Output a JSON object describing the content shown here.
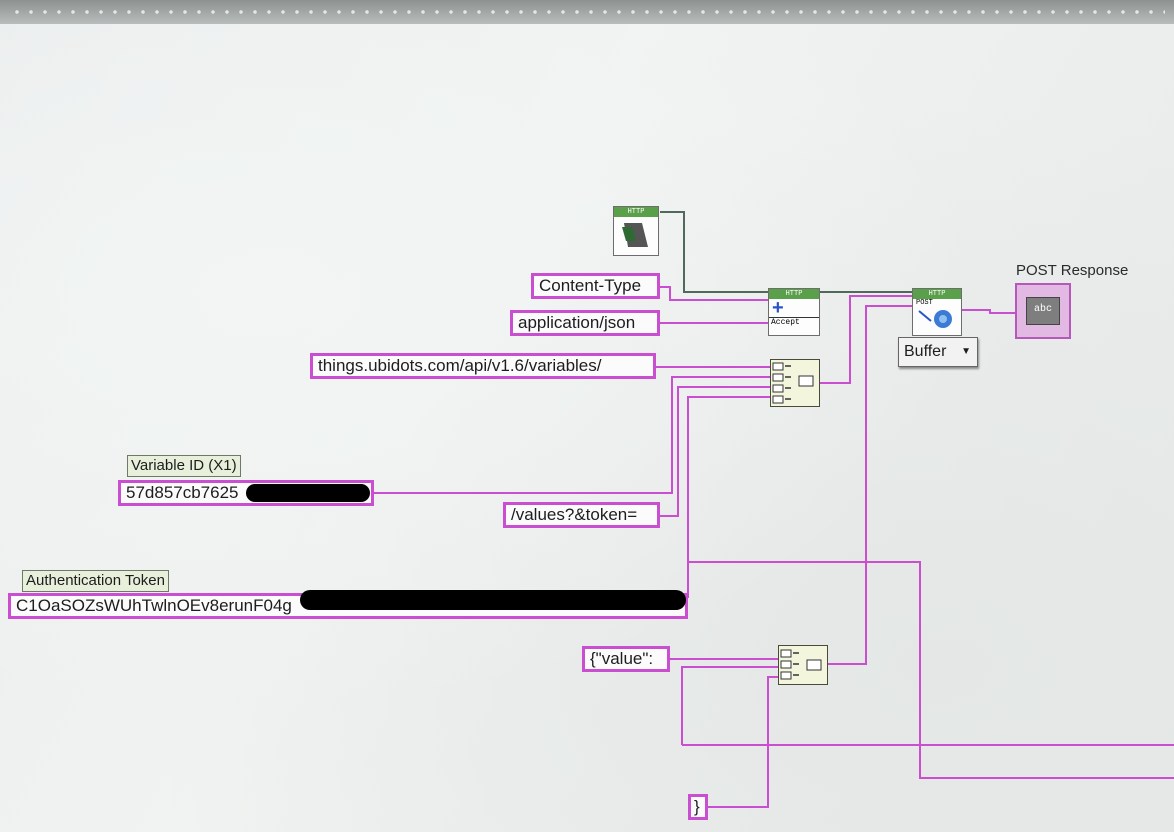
{
  "constants": {
    "content_type": "Content-Type",
    "application_json": "application/json",
    "url_base": "things.ubidots.com/api/v1.6/variables/",
    "variable_id": "57d857cb7625",
    "values_token": "/values?&token=",
    "auth_token": "C1OaSOZsWUhTwlnOEv8erunF04g",
    "value_prefix": "{\"value\":",
    "close_brace": "}"
  },
  "labels": {
    "variable_id": "Variable ID (X1)",
    "auth_token": "Authentication Token",
    "post_response": "POST Response"
  },
  "nodes": {
    "http_header": "HTTP",
    "post_mode": "POST",
    "add_header_caption": "Accept",
    "indicator_glyph": "abc"
  },
  "ring": {
    "value": "Buffer"
  },
  "colors": {
    "string_wire": "#c94fd0",
    "refnum_wire": "#4f6a5a",
    "indicator_fill": "#e2b9e3"
  }
}
